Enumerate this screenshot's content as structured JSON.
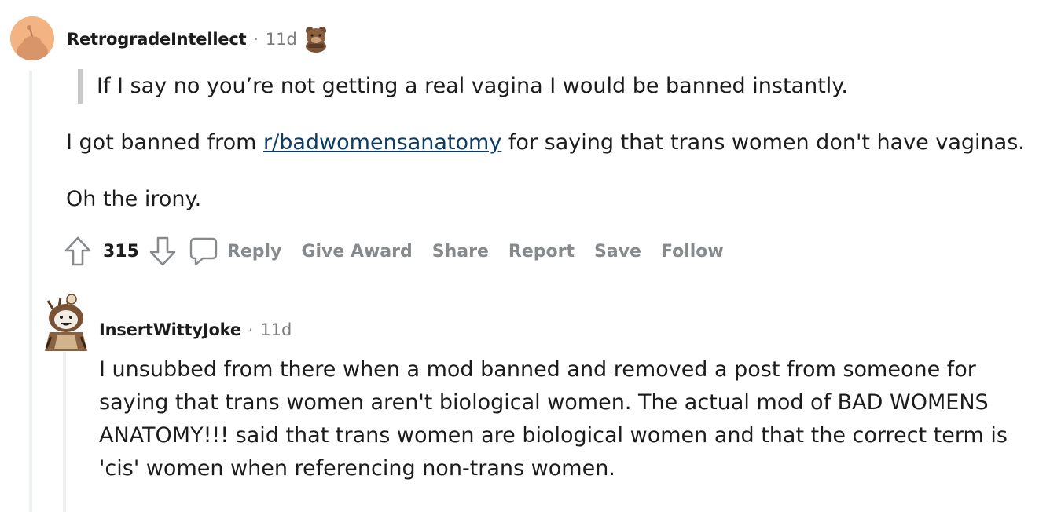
{
  "comment1": {
    "username": "RetrogradeIntellect",
    "separator": "·",
    "time": "11d",
    "quote": "If I say no you’re not getting a real vagina I would be banned instantly.",
    "paragraph1_before": "I got banned from ",
    "paragraph1_link": "r/badwomensanatomy",
    "paragraph1_after": " for saying that trans women don't have vaginas.",
    "paragraph2": "Oh the irony.",
    "vote_count": "315",
    "actions": {
      "reply": "Reply",
      "give_award": "Give Award",
      "share": "Share",
      "report": "Report",
      "save": "Save",
      "follow": "Follow"
    }
  },
  "comment2": {
    "username": "InsertWittyJoke",
    "separator": "·",
    "time": "11d",
    "lines": [
      "I unsubbed from there when a mod banned and removed a post from someone for",
      "saying that trans women aren't biological women. The actual mod of BAD WOMENS",
      "ANATOMY!!! said that trans women are biological women and that the correct term is",
      "'cis' women when referencing non-trans women."
    ]
  },
  "colors": {
    "avatar1_bg": "#f4b383",
    "link": "#0e3d63",
    "action_gray": "#878a8c",
    "thread_line": "#edeff1"
  }
}
